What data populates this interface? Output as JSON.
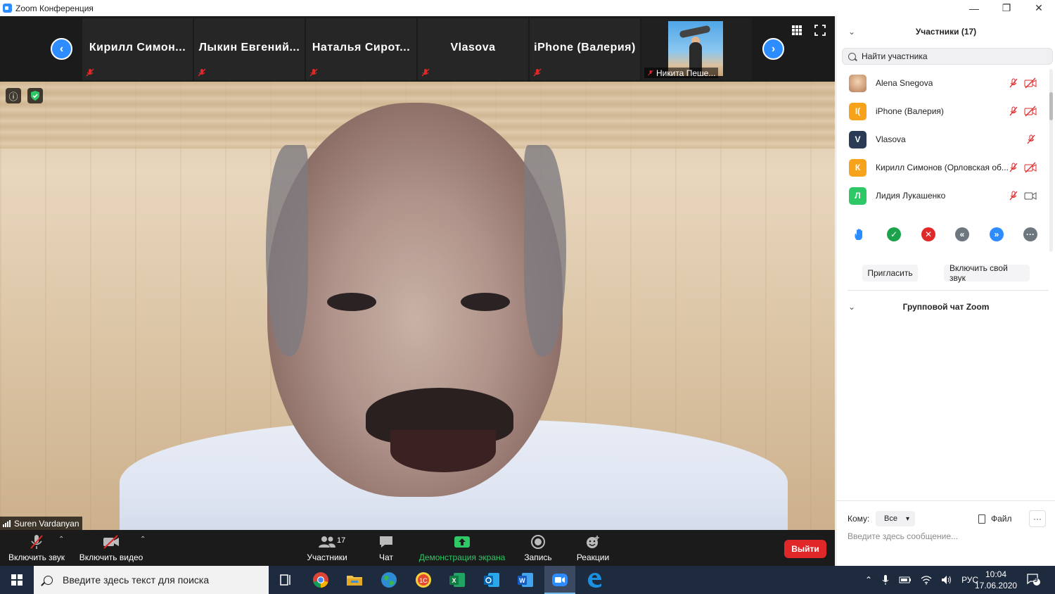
{
  "window": {
    "title": "Zoom Конференция",
    "controls": [
      "—",
      "❐",
      "✕"
    ]
  },
  "strip": {
    "tiles": [
      {
        "name": "Кирилл  Симон..."
      },
      {
        "name": "Лыкин  Евгений..."
      },
      {
        "name": "Наталья  Сирот..."
      },
      {
        "name": "Vlasova"
      },
      {
        "name": "iPhone (Валерия)"
      }
    ],
    "photo_tile_name": "Никита Пеше..."
  },
  "video": {
    "speaker_name": "Suren Vardanyan"
  },
  "toolbar": {
    "unmute_label": "Включить звук",
    "start_video_label": "Включить видео",
    "participants_label": "Участники",
    "participants_count": "17",
    "chat_label": "Чат",
    "share_label": "Демонстрация экрана",
    "record_label": "Запись",
    "reactions_label": "Реакции",
    "leave_label": "Выйти",
    "share_color": "#2ec866",
    "leave_color": "#e02828"
  },
  "panel": {
    "title": "Участники (17)",
    "search_placeholder": "Найти участника",
    "participants": [
      {
        "name": "Alena Snegova",
        "initial": "",
        "avatar_color": "",
        "video_off": true
      },
      {
        "name": "iPhone (Валерия)",
        "initial": "I(",
        "avatar_color": "#f7a21b",
        "video_off": true
      },
      {
        "name": "Vlasova",
        "initial": "V",
        "avatar_color": "#2b3a55",
        "video_off": false
      },
      {
        "name": "Кирилл Симонов (Орловская об...",
        "initial": "К",
        "avatar_color": "#f7a21b",
        "video_off": true
      },
      {
        "name": "Лидия Лукашенко",
        "initial": "Л",
        "avatar_color": "#2ec866",
        "video_off": false
      }
    ],
    "invite_label": "Пригласить",
    "unmute_me_label": "Включить свой звук",
    "chat_title": "Групповой чат Zoom",
    "to_label": "Кому:",
    "to_value": "Все",
    "file_label": "Файл",
    "more_label": "···",
    "message_placeholder": "Введите здесь сообщение..."
  },
  "taskbar": {
    "search_placeholder": "Введите здесь текст для поиска",
    "language": "РУС",
    "time": "10:04",
    "date": "17.06.2020",
    "notifications": "9"
  }
}
